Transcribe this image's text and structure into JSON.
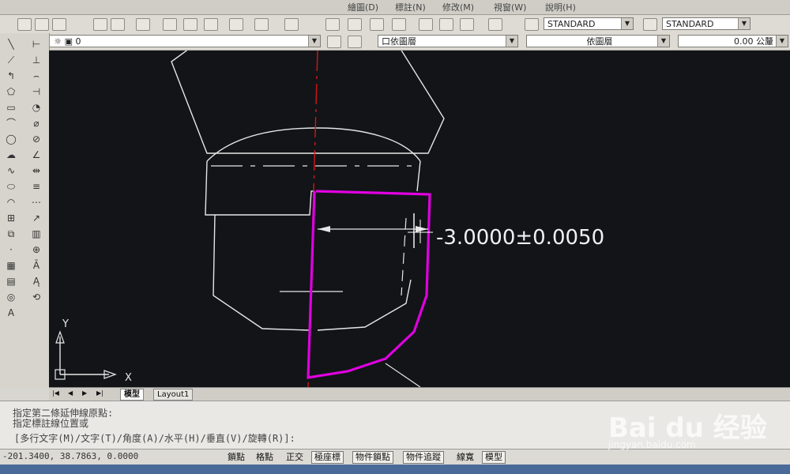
{
  "menu": {
    "items": [
      "繪圖(D)",
      "標註(N)",
      "修改(M)",
      "視窗(W)",
      "說明(H)"
    ]
  },
  "toolbar": {
    "layer_value": "0",
    "color_value": "口依圖層",
    "text_style": "STANDARD",
    "dim_style": "STANDARD",
    "linetype_value": "依圖層",
    "lineweight_value": "0.00 公釐"
  },
  "drawing": {
    "dimension_text": "-3.0000±0.0050",
    "ucs_x_label": "X",
    "ucs_y_label": "Y",
    "colors": {
      "background": "#121418",
      "geometry": "#e6e6e6",
      "selection": "#e000e0",
      "centerline": "#d01818"
    }
  },
  "tabs": {
    "model": "模型",
    "layout1": "Layout1"
  },
  "command": {
    "line1": "指定第二條延伸線原點:",
    "line2": "指定標註線位置或",
    "line3": "[多行文字(M)/文字(T)/角度(A)/水平(H)/垂直(V)/旋轉(R)]:"
  },
  "status": {
    "coordinates": "-201.3400, 38.7863, 0.0000",
    "buttons": [
      {
        "label": "鎖點",
        "on": false
      },
      {
        "label": "格點",
        "on": false
      },
      {
        "label": "正交",
        "on": false
      },
      {
        "label": "極座標",
        "on": true
      },
      {
        "label": "物件鎖點",
        "on": true
      },
      {
        "label": "物件追蹤",
        "on": true
      },
      {
        "label": "線寬",
        "on": false
      },
      {
        "label": "模型",
        "on": true
      }
    ]
  },
  "watermark": {
    "brand": "Bai du 经验",
    "url": "jingyan.baidu.com"
  }
}
